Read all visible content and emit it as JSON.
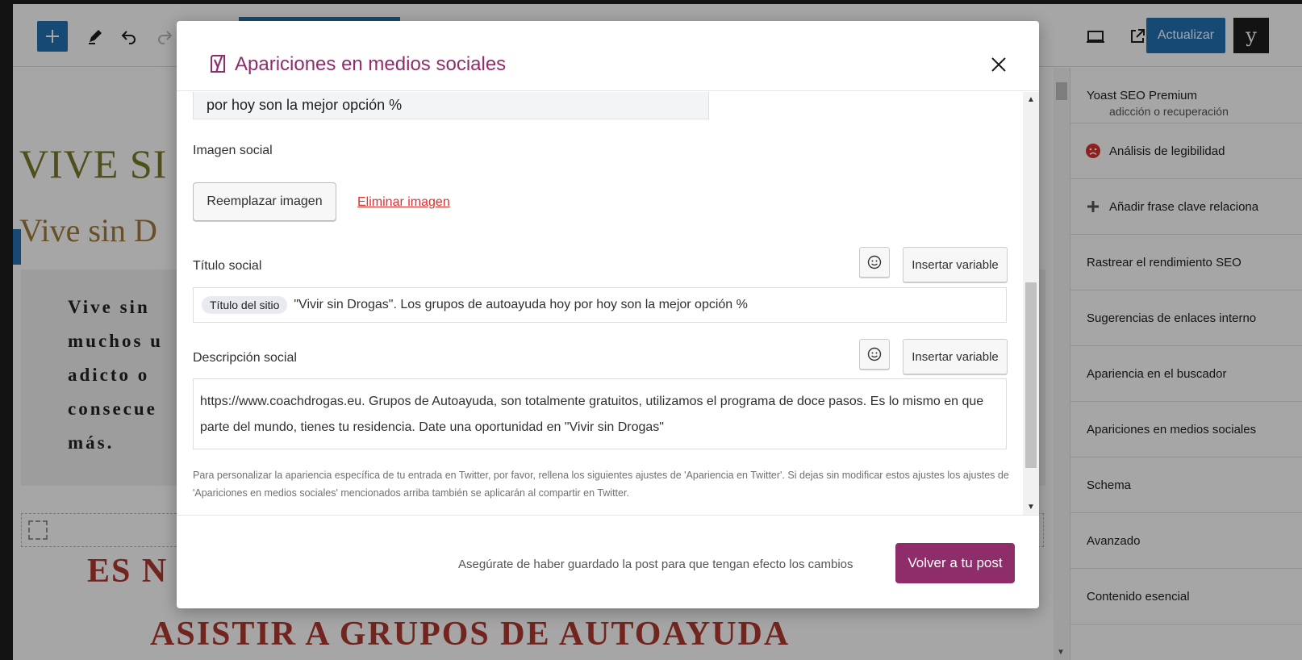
{
  "toolbar": {
    "add_icon": "plus-icon",
    "update_label": "Actualizar",
    "yoast_glyph": "y"
  },
  "editor": {
    "heading1": "VIVE SI",
    "heading2": "Vive sin D",
    "paragraph_lines": [
      "Vive sin",
      "muchos u",
      "adicto o",
      "consecue",
      "más."
    ],
    "heading3": "ES N",
    "heading4": "ASISTIR A GRUPOS DE AUTOAYUDA"
  },
  "sidebar": {
    "items": [
      {
        "label": "Yoast SEO Premium",
        "sub": "adicción o recuperación"
      },
      {
        "label": "Análisis de legibilidad",
        "icon": "sad-face-icon"
      },
      {
        "label": "Añadir frase clave relaciona",
        "icon": "plus-icon"
      },
      {
        "label": "Rastrear el rendimiento SEO"
      },
      {
        "label": "Sugerencias de enlaces interno"
      },
      {
        "label": "Apariencia en el buscador"
      },
      {
        "label": "Apariciones en medios sociales"
      },
      {
        "label": "Schema"
      },
      {
        "label": "Avanzado"
      },
      {
        "label": "Contenido esencial"
      }
    ]
  },
  "modal": {
    "title": "Apariciones en medios sociales",
    "preview_title_fragment": "por hoy son la mejor opción %",
    "social_image_label": "Imagen social",
    "replace_image": "Reemplazar imagen",
    "remove_image": "Eliminar imagen",
    "social_title_label": "Título social",
    "insert_variable": "Insertar variable",
    "site_title_pill": "Título del sitio",
    "social_title_text": "\"Vivir sin Drogas\". Los grupos de autoayuda hoy por hoy son la mejor opción %",
    "social_desc_label": "Descripción social",
    "social_desc_text": "https://www.coachdrogas.eu. Grupos de Autoayuda, son totalmente gratuitos, utilizamos el programa de doce pasos. Es lo mismo en que parte del mundo, tienes tu residencia. Date una oportunidad en \"Vivir sin Drogas\"",
    "help_text": "Para personalizar la apariencia específica de tu entrada en Twitter, por favor, rellena los siguientes ajustes de 'Apariencia en Twitter'. Si dejas sin modificar estos ajustes los ajustes de 'Apariciones en medios sociales' mencionados arriba también se aplicarán al compartir en Twitter.",
    "footer_note": "Asegúrate de haber guardado la post para que tengan efecto los cambios",
    "back_button": "Volver a tu post"
  },
  "colors": {
    "yoast_purple": "#8f2d6b",
    "wp_blue": "#2271b1",
    "danger": "#dc3232"
  }
}
